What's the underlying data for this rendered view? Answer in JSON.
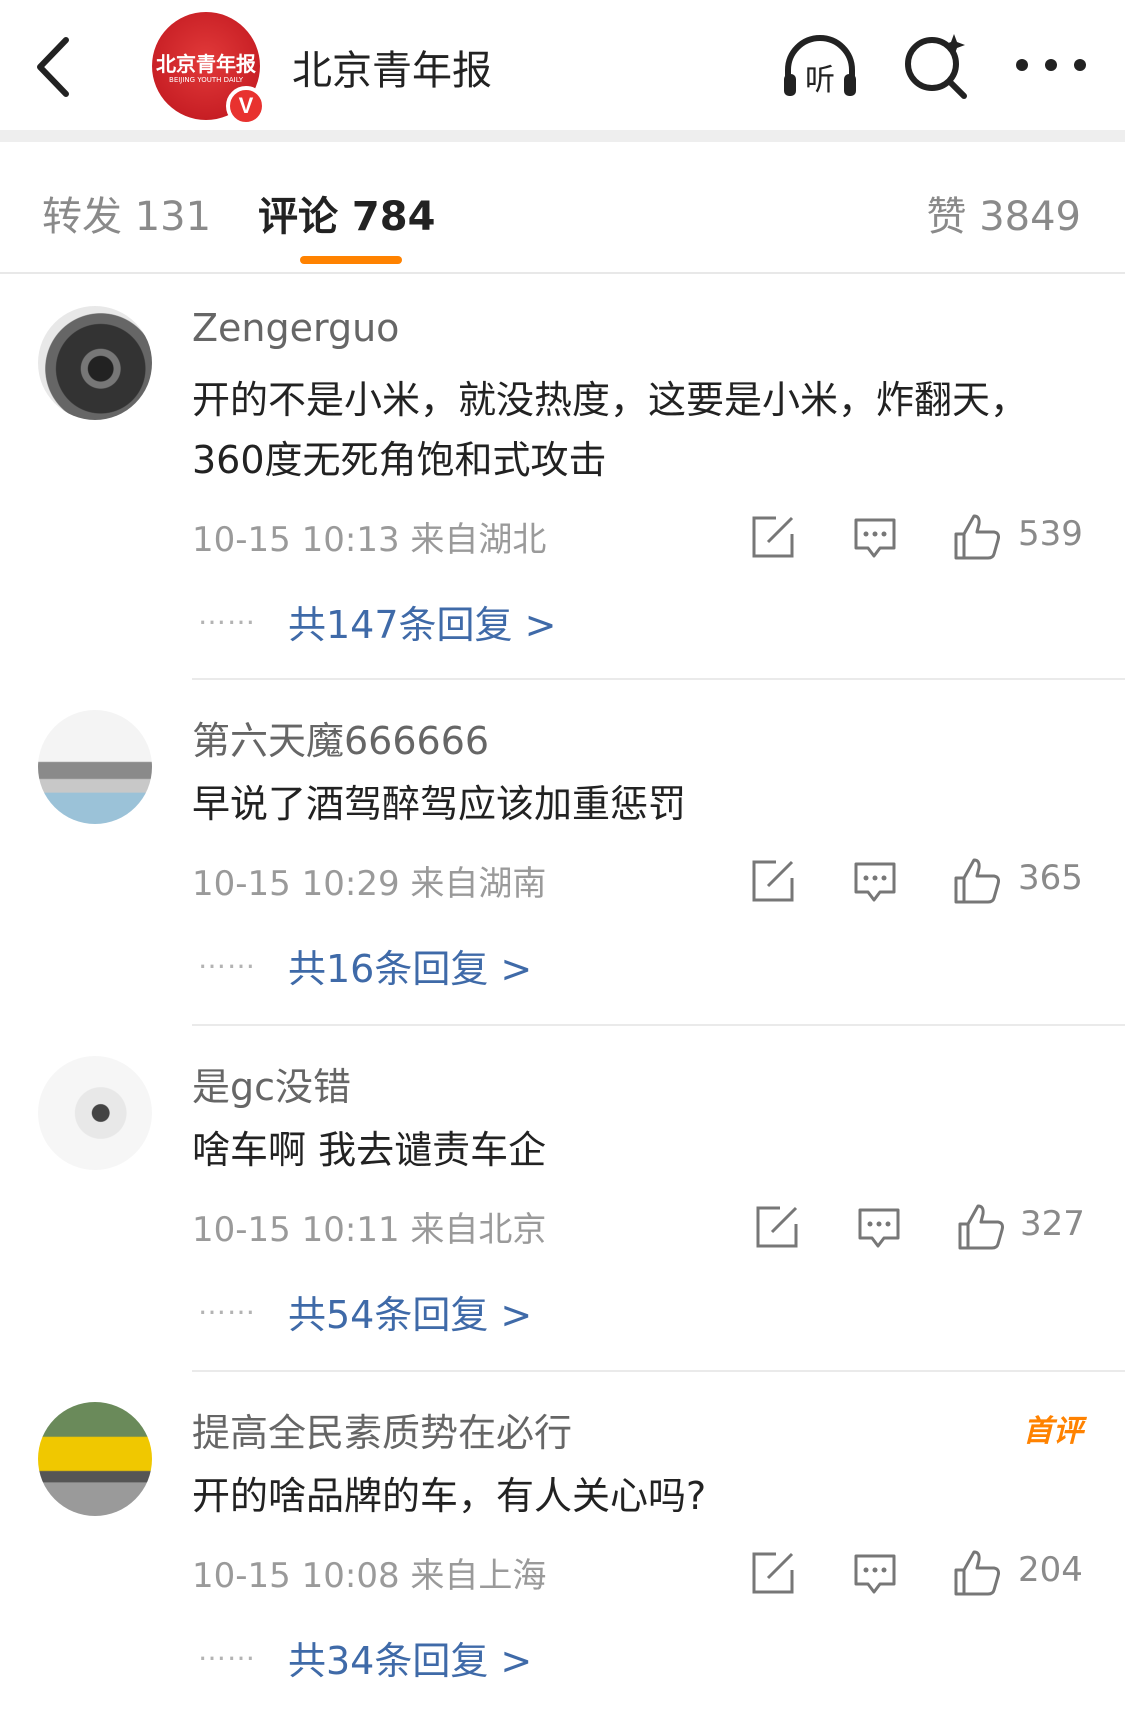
{
  "header": {
    "account_name": "北京青年报",
    "logo_text": "北京青年报",
    "logo_sub": "BEIJING YOUTH DAILY",
    "verified_mark": "V",
    "listen_label": "听"
  },
  "tabs": {
    "repost": "转发 131",
    "comments": "评论 784",
    "likes": "赞 3849"
  },
  "colors": {
    "accent": "#ff8200",
    "link": "#3f6aa8",
    "verified": "#e8322f"
  },
  "comments": [
    {
      "user": "Zengerguo",
      "text": "开的不是小米，就没热度，这要是小米，炸翻天，360度无死角饱和式攻击",
      "meta": "10-15 10:13 来自湖北",
      "likes": "539",
      "dots": "……",
      "replies": "共147条回复 >",
      "avatar_icon": "brake-disc-avatar"
    },
    {
      "user": "第六天魔666666",
      "text": "早说了酒驾醉驾应该加重惩罚",
      "meta": "10-15 10:29 来自湖南",
      "likes": "365",
      "dots": "……",
      "replies": "共16条回复 >",
      "avatar_icon": "boat-crowd-avatar"
    },
    {
      "user": "是gc没错",
      "text": "啥车啊 我去谴责车企",
      "meta": "10-15 10:11 来自北京",
      "likes": "327",
      "dots": "……",
      "replies": "共54条回复 >",
      "avatar_icon": "snowboarder-avatar"
    },
    {
      "user": "提高全民素质势在必行",
      "text": "开的啥品牌的车，有人关心吗?",
      "meta": "10-15 10:08 来自上海",
      "likes": "204",
      "dots": "……",
      "replies": "共34条回复 >",
      "badge": "首评",
      "avatar_icon": "yellow-car-avatar"
    }
  ]
}
